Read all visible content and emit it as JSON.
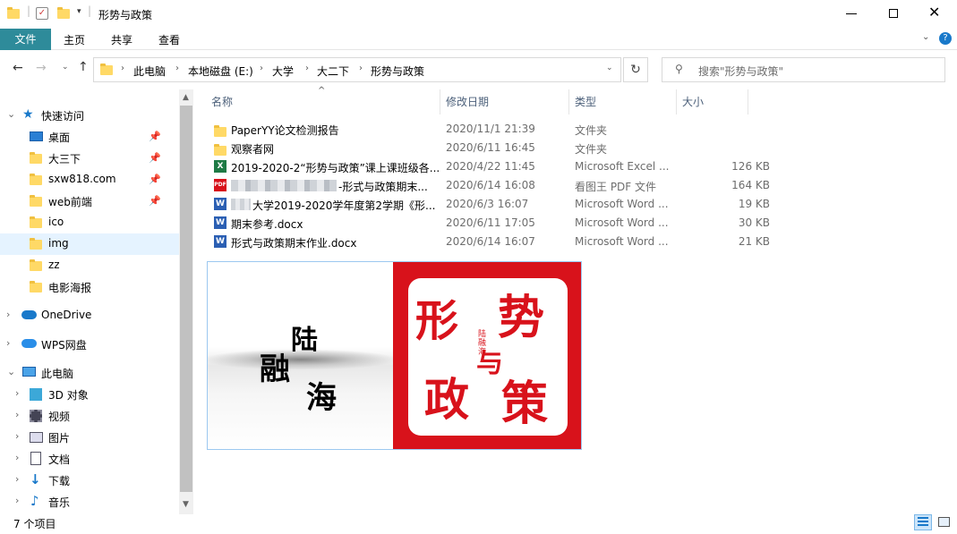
{
  "window": {
    "title": "形势与政策"
  },
  "ribbon": {
    "tabs": [
      "文件",
      "主页",
      "共享",
      "查看"
    ]
  },
  "address": {
    "segments": [
      "此电脑",
      "本地磁盘 (E:)",
      "大学",
      "大二下",
      "形势与政策"
    ]
  },
  "search": {
    "placeholder": "搜索\"形势与政策\""
  },
  "columns": {
    "name": "名称",
    "date": "修改日期",
    "type": "类型",
    "size": "大小"
  },
  "sidebar": {
    "quick_access": "快速访问",
    "items": [
      {
        "label": "桌面",
        "icon": "desktop-icon",
        "pinned": true
      },
      {
        "label": "大三下",
        "icon": "folder-icon",
        "pinned": true
      },
      {
        "label": "sxw818.com",
        "icon": "folder-icon",
        "pinned": true
      },
      {
        "label": "web前端",
        "icon": "folder-icon",
        "pinned": true
      },
      {
        "label": "ico",
        "icon": "folder-icon",
        "pinned": false
      },
      {
        "label": "img",
        "icon": "folder-icon",
        "pinned": false
      },
      {
        "label": "zz",
        "icon": "folder-icon",
        "pinned": false
      },
      {
        "label": "电影海报",
        "icon": "folder-icon",
        "pinned": false
      }
    ],
    "onedrive": "OneDrive",
    "wps": "WPS网盘",
    "this_pc": "此电脑",
    "pc_items": [
      {
        "label": "3D 对象",
        "icon": "3d-objects-icon"
      },
      {
        "label": "视频",
        "icon": "video-icon"
      },
      {
        "label": "图片",
        "icon": "pictures-icon"
      },
      {
        "label": "文档",
        "icon": "documents-icon"
      },
      {
        "label": "下载",
        "icon": "downloads-icon"
      },
      {
        "label": "音乐",
        "icon": "music-icon"
      }
    ]
  },
  "files": [
    {
      "name": "PaperYY论文检测报告",
      "date": "2020/11/1 21:39",
      "type": "文件夹",
      "size": "",
      "icon": "folder-icon"
    },
    {
      "name": "观察者网",
      "date": "2020/6/11 16:45",
      "type": "文件夹",
      "size": "",
      "icon": "folder-icon"
    },
    {
      "name": "2019-2020-2“形势与政策”课上课班级各...",
      "date": "2020/4/22 11:45",
      "type": "Microsoft Excel ...",
      "size": "126 KB",
      "icon": "excel-icon"
    },
    {
      "name": "-形式与政策期末...",
      "date": "2020/6/14 16:08",
      "type": "看图王 PDF 文件",
      "size": "164 KB",
      "icon": "pdf-icon"
    },
    {
      "name": "大学2019-2020学年度第2学期《形...",
      "date": "2020/6/3 16:07",
      "type": "Microsoft Word ...",
      "size": "19 KB",
      "icon": "word-icon"
    },
    {
      "name": "期末参考.docx",
      "date": "2020/6/11 17:05",
      "type": "Microsoft Word ...",
      "size": "30 KB",
      "icon": "word-icon"
    },
    {
      "name": "形式与政策期末作业.docx",
      "date": "2020/6/14 16:07",
      "type": "Microsoft Word ...",
      "size": "21 KB",
      "icon": "word-icon"
    }
  ],
  "preview": {
    "left_text": [
      "陆",
      "融",
      "海"
    ],
    "right_text": [
      "形",
      "势",
      "与",
      "政",
      "策"
    ],
    "small_text": "陆融海"
  },
  "status": {
    "count": "7 个项目"
  },
  "colors": {
    "accent": "#1979ca",
    "file_tab": "#2e8b9a",
    "red": "#d8121b"
  }
}
